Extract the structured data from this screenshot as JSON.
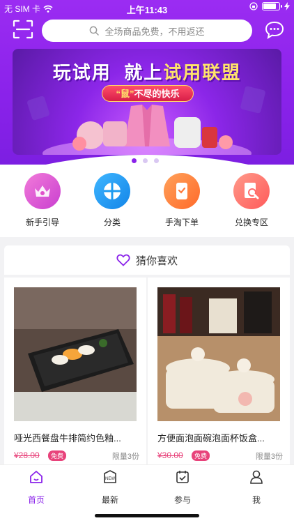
{
  "status": {
    "carrier": "无 SIM 卡",
    "time": "上午11:43"
  },
  "search": {
    "placeholder": "全场商品免费，不用返还"
  },
  "banner": {
    "title_part1": "玩试用",
    "title_part2": "就上",
    "title_part3": "试用联盟",
    "sub_prefix": "“鼠”",
    "sub_suffix": "不尽的快乐",
    "slide_count": 3,
    "active_slide": 1
  },
  "quick_nav": [
    {
      "label": "新手引导",
      "icon": "crown-icon",
      "color": "#e04fcb"
    },
    {
      "label": "分类",
      "icon": "grid-icon",
      "color": "#1e9bf0"
    },
    {
      "label": "手淘下单",
      "icon": "phone-icon",
      "color": "#ff7a3c"
    },
    {
      "label": "兑换专区",
      "icon": "exchange-icon",
      "color": "#ff6b6b"
    }
  ],
  "recommend": {
    "title": "猜你喜欢",
    "items": [
      {
        "name": "哑光西餐盘牛排简约色釉...",
        "price": "¥28.00",
        "badge": "免费",
        "limit": "限量3份"
      },
      {
        "name": "方便面泡面碗泡面杯饭盒...",
        "price": "¥30.00",
        "badge": "免费",
        "limit": "限量3份"
      }
    ]
  },
  "tabbar": [
    {
      "label": "首页",
      "icon": "home-icon",
      "active": true
    },
    {
      "label": "最新",
      "icon": "new-icon",
      "active": false
    },
    {
      "label": "参与",
      "icon": "calendar-check-icon",
      "active": false
    },
    {
      "label": "我",
      "icon": "user-icon",
      "active": false
    }
  ],
  "colors": {
    "primary": "#8a22ea",
    "price": "#e8437b"
  }
}
